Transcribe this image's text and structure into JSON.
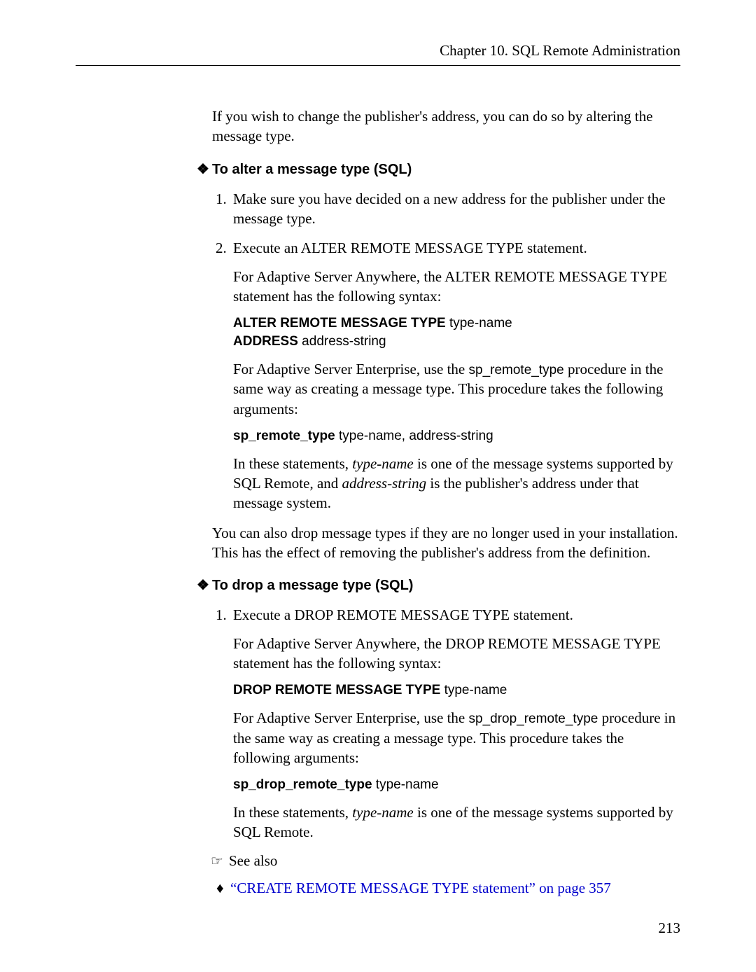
{
  "header": "Chapter 10.  SQL Remote Administration",
  "intro": "If you wish to change the publisher's address, you can do so by altering the message type.",
  "section1": {
    "title": "To alter a message type (SQL)",
    "step1": "Make sure you have decided on a new address for the publisher under the message type.",
    "step2": "Execute an ALTER REMOTE MESSAGE TYPE statement.",
    "s2a": "For Adaptive Server Anywhere, the ALTER REMOTE MESSAGE TYPE statement has the following syntax:",
    "code1_line1_kw": "ALTER REMOTE MESSAGE TYPE",
    "code1_line1_arg": " type-name",
    "code1_line2_kw": "ADDRESS",
    "code1_line2_arg": " address-string",
    "s2b_pre": "For Adaptive Server Enterprise, use the ",
    "s2b_code": "sp_remote_type",
    "s2b_post": " procedure in the same way as creating a message type. This procedure takes the following arguments:",
    "code2_kw": "sp_remote_type",
    "code2_arg": " type-name, address-string",
    "s2c_pre": "In these statements, ",
    "s2c_i1": "type-name",
    "s2c_mid": " is one of the message systems supported by SQL Remote, and ",
    "s2c_i2": "address-string",
    "s2c_post": " is the publisher's address under that message system."
  },
  "mid_para": "You can also drop message types if they are no longer used in your installation. This has the effect of removing the publisher's address from the definition.",
  "section2": {
    "title": "To drop a message type (SQL)",
    "step1": "Execute a DROP REMOTE MESSAGE TYPE statement.",
    "s1a": "For Adaptive Server Anywhere, the DROP REMOTE MESSAGE TYPE statement has the following syntax:",
    "code1_kw": "DROP REMOTE MESSAGE TYPE",
    "code1_arg": " type-name",
    "s1b_pre": "For Adaptive Server Enterprise, use the ",
    "s1b_code": "sp_drop_remote_type",
    "s1b_post": " procedure in the same way as creating a message type. This procedure takes the following arguments:",
    "code2_kw": "sp_drop_remote_type",
    "code2_arg": " type-name",
    "s1c_pre": "In these statements, ",
    "s1c_i1": "type-name",
    "s1c_post": " is one of the message systems supported by SQL Remote."
  },
  "see_also": "See also",
  "link_text": "“CREATE REMOTE MESSAGE TYPE statement” on page 357",
  "page_number": "213",
  "glyphs": {
    "diamond": "❖",
    "hand": "☞",
    "bullet": "♦"
  }
}
